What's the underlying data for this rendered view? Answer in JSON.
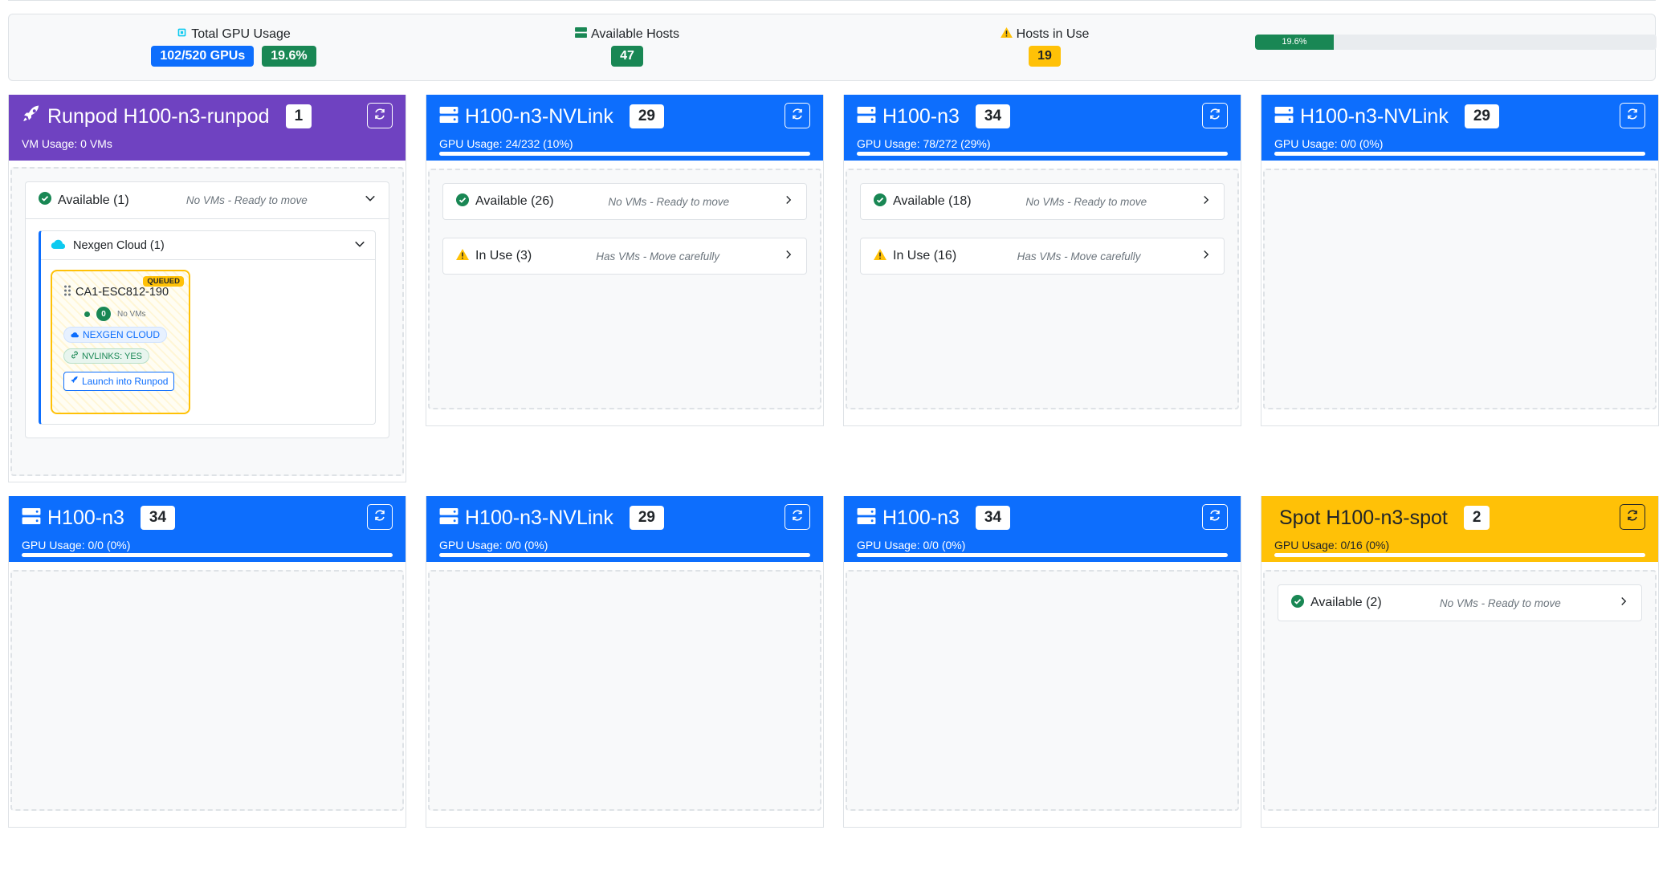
{
  "summary": {
    "total_gpu_label": "Total GPU Usage",
    "total_gpu_count": "102/520 GPUs",
    "total_gpu_pct": "19.6%",
    "available_hosts_label": "Available Hosts",
    "available_hosts_value": "47",
    "hosts_in_use_label": "Hosts in Use",
    "hosts_in_use_value": "19",
    "progress_label": "19.6%",
    "progress_fraction": 0.196
  },
  "columns": [
    {
      "title": "Runpod H100-n3-runpod",
      "count": "1",
      "sub": "VM Usage: 0 VMs",
      "color": "#6f42c1"
    },
    {
      "title": "H100-n3-NVLink",
      "count": "29",
      "sub": "GPU Usage: 24/232 (10%)",
      "color": "#0d6efd"
    },
    {
      "title": "H100-n3",
      "count": "34",
      "sub": "GPU Usage: 78/272 (29%)",
      "color": "#0d6efd"
    },
    {
      "title": "H100-n3-NVLink",
      "count": "29",
      "sub": "GPU Usage: 0/0 (0%)",
      "color": "#0d6efd"
    },
    {
      "title": "H100-n3",
      "count": "34",
      "sub": "GPU Usage: 0/0 (0%)",
      "color": "#0d6efd"
    },
    {
      "title": "H100-n3-NVLink",
      "count": "29",
      "sub": "GPU Usage: 0/0 (0%)",
      "color": "#0d6efd"
    },
    {
      "title": "H100-n3",
      "count": "34",
      "sub": "GPU Usage: 0/0 (0%)",
      "color": "#0d6efd"
    },
    {
      "title": "Spot H100-n3-spot",
      "count": "2",
      "sub": "GPU Usage: 0/16 (0%)",
      "color": "#ffc107"
    }
  ],
  "groups": {
    "runpod_available": {
      "label": "Available (1)",
      "hint": "No VMs - Ready to move"
    },
    "nexgen": {
      "label": "Nexgen Cloud (1)"
    },
    "c1_available": {
      "label": "Available (26)",
      "hint": "No VMs - Ready to move"
    },
    "c1_inuse": {
      "label": "In Use (3)",
      "hint": "Has VMs - Move carefully"
    },
    "c2_available": {
      "label": "Available (18)",
      "hint": "No VMs - Ready to move"
    },
    "c2_inuse": {
      "label": "In Use (16)",
      "hint": "Has VMs - Move carefully"
    },
    "spot_available": {
      "label": "Available (2)",
      "hint": "No VMs - Ready to move"
    }
  },
  "host": {
    "queued": "QUEUED",
    "name": "CA1-ESC812-190",
    "vm_count": "0",
    "vm_text": "No VMs",
    "cloud_tag": "NEXGEN CLOUD",
    "nvlinks_tag": "NVLINKS: YES",
    "launch_label": "Launch into Runpod"
  }
}
